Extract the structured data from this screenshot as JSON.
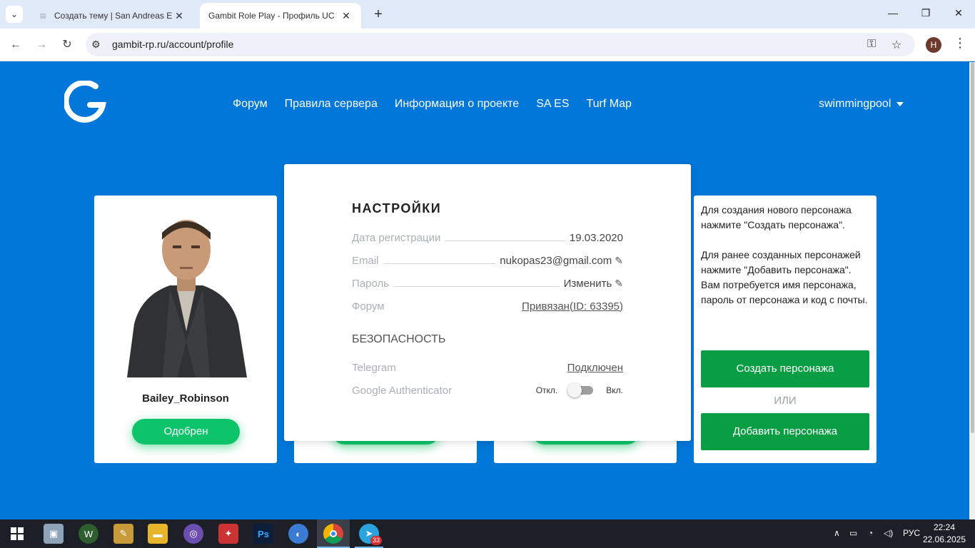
{
  "browser": {
    "tabs": [
      {
        "title": "Создать тему | San Andreas Em",
        "active": false
      },
      {
        "title": "Gambit Role Play - Профиль UC",
        "active": true
      }
    ],
    "url": "gambit-rp.ru/account/profile",
    "profile_initial": "H"
  },
  "site": {
    "nav": [
      "Форум",
      "Правила сервера",
      "Информация о проекте",
      "SA ES",
      "Turf Map"
    ],
    "username": "swimmingpool"
  },
  "character": {
    "name": "Bailey_Robinson",
    "status": "Одобрен"
  },
  "settings": {
    "title": "НАСТРОЙКИ",
    "rows": [
      {
        "label": "Дата регистрации",
        "value": "19.03.2020"
      },
      {
        "label": "Email",
        "value": "nukopas23@gmail.com"
      },
      {
        "label": "Пароль",
        "value": "Изменить"
      },
      {
        "label": "Форум",
        "value": "Привязан(ID: 63395)"
      }
    ],
    "security_title": "БЕЗОПАСНОСТЬ",
    "security": [
      {
        "label": "Telegram",
        "value": "Подключен"
      },
      {
        "label": "Google Authenticator",
        "off": "Откл.",
        "on": "Вкл."
      }
    ]
  },
  "info": {
    "text1": "Для создания нового персонажа нажмите \"Создать персонажа\".",
    "text2": "Для ранее созданных персонажей нажмите \"Добавить персонажа\". Вам потребуется имя персонажа, пароль от персонажа и код с почты.",
    "create_button": "Создать персонажа",
    "or": "ИЛИ",
    "add_button": "Добавить персонажа"
  },
  "taskbar": {
    "telegram_badge": "33",
    "language": "РУС",
    "time": "22:24",
    "date": "22.06.2025"
  }
}
